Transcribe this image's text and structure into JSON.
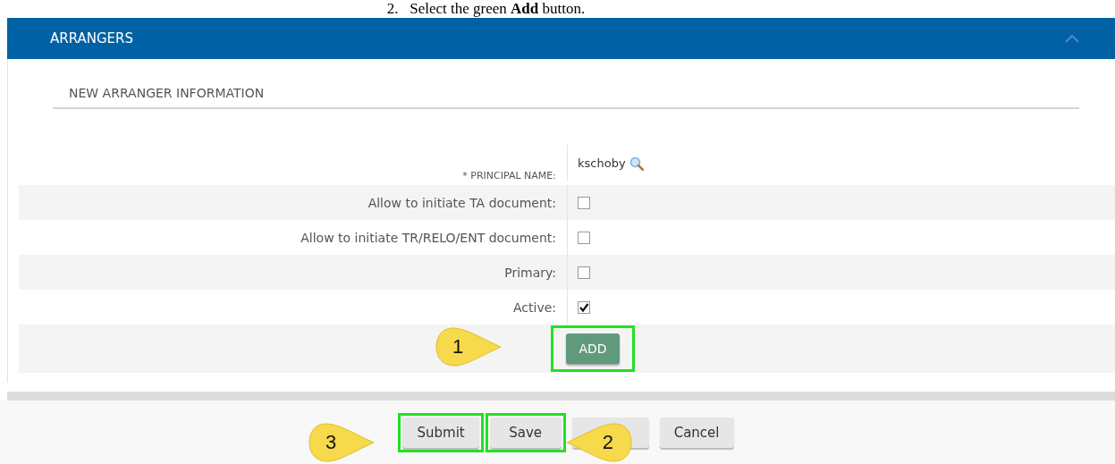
{
  "instruction": {
    "number": "2.",
    "text": "Select the green **Add** button."
  },
  "panel": {
    "title": "ARRANGERS",
    "expanded": true
  },
  "section": {
    "title": "NEW ARRANGER INFORMATION"
  },
  "fields": [
    {
      "kind": "text",
      "label": "* PRINCIPAL NAME:",
      "value": "kschoby"
    },
    {
      "kind": "checkbox",
      "label": "Allow to initiate TA document:",
      "checked": false
    },
    {
      "kind": "checkbox",
      "label": "Allow to initiate TR/RELO/ENT document:",
      "checked": false
    },
    {
      "kind": "checkbox",
      "label": "Primary:",
      "checked": false
    },
    {
      "kind": "checkbox",
      "label": "Active:",
      "checked": true
    }
  ],
  "add_button": {
    "label": "ADD",
    "highlighted": true
  },
  "footer_buttons": [
    {
      "label": "Submit",
      "highlighted": true
    },
    {
      "label": "Save",
      "highlighted": true
    },
    {
      "highlighted": false
    },
    {
      "label": "Cancel",
      "highlighted": false
    }
  ],
  "callouts": [
    {
      "number": "1"
    },
    {
      "number": "3"
    },
    {
      "number": "2"
    }
  ]
}
